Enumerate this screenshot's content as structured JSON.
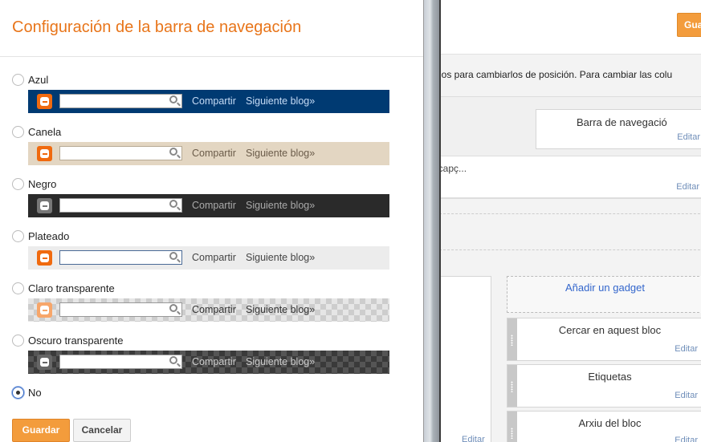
{
  "dialog": {
    "title": "Configuración de la barra de navegación",
    "options": [
      {
        "label": "Azul",
        "selected": false
      },
      {
        "label": "Canela",
        "selected": false
      },
      {
        "label": "Negro",
        "selected": false
      },
      {
        "label": "Plateado",
        "selected": false
      },
      {
        "label": "Claro transparente",
        "selected": false
      },
      {
        "label": "Oscuro transparente",
        "selected": false
      },
      {
        "label": "No",
        "selected": true
      }
    ],
    "preview": {
      "share_label": "Compartir",
      "next_blog_label": "Siguiente blog»"
    },
    "save_label": "Guardar",
    "cancel_label": "Cancelar"
  },
  "background": {
    "save_label": "Gua",
    "description": "los para cambiarlos de posición. Para cambiar las colu",
    "navbar_gadget_title": "Barra de navegació",
    "header_text": "ncapç...",
    "left_link": "t",
    "add_gadget_label": "Añadir un gadget",
    "gadgets": [
      {
        "title": "Cercar en aquest bloc"
      },
      {
        "title": "Etiquetas"
      },
      {
        "title": "Arxiu del bloc"
      }
    ],
    "edit_label": "Editar"
  },
  "colors": {
    "accent_orange": "#e8751a",
    "button_orange": "#f39c3c",
    "bar_blue": "#003a72",
    "bar_tan": "#e3d6c2",
    "bar_black": "#2a2a2a",
    "bar_silver": "#ececec"
  }
}
